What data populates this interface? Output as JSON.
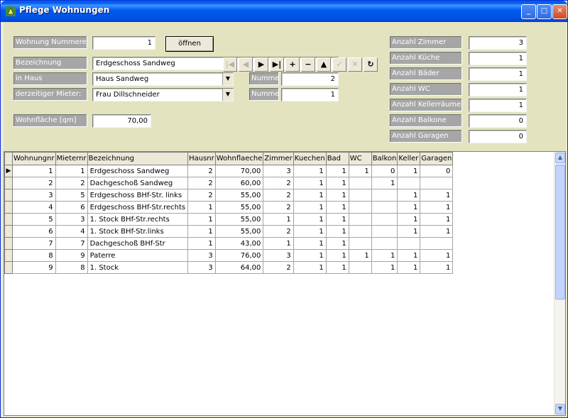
{
  "window": {
    "title": "Pflege Wohnungen",
    "minimize": "_",
    "maximize": "□",
    "close": "✕"
  },
  "form": {
    "wohnung_label": "Wohnung Nummerer",
    "wohnung_value": "1",
    "oeffnen_label": "öffnen",
    "bezeichnung_label": "Bezeichnung",
    "bezeichnung_value": "Erdgeschoss Sandweg",
    "haus_label": "in Haus",
    "haus_value": "Haus Sandweg",
    "haus_nummer_label": "Nummer",
    "haus_nummer_value": "2",
    "mieter_label": "derzeitiger Mieter:",
    "mieter_value": "Frau Dillschneider",
    "mieter_nummer_label": "Nummer",
    "mieter_nummer_value": "1",
    "flaeche_label": "Wohnfläche [qm]",
    "flaeche_value": "70,00"
  },
  "nav": {
    "first": "|◀",
    "prev": "◀",
    "next": "▶",
    "last": "▶|",
    "insert": "+",
    "delete": "−",
    "edit": "▲",
    "post": "✓",
    "cancel": "✕",
    "refresh": "↻"
  },
  "counts": {
    "zimmer_label": "Anzahl Zimmer",
    "zimmer_value": "3",
    "kueche_label": "Anzahl Küche",
    "kueche_value": "1",
    "baeder_label": "Anzahl Bäder",
    "baeder_value": "1",
    "wc_label": "Anzahl WC",
    "wc_value": "1",
    "keller_label": "Anzahl Kellerräume",
    "keller_value": "1",
    "balkone_label": "Anzahl Balkone",
    "balkone_value": "0",
    "garagen_label": "Anzahl Garagen",
    "garagen_value": "0"
  },
  "grid": {
    "columns": [
      "Wohnungnr",
      "Mieternr",
      "Bezeichnung",
      "Hausnr",
      "Wohnflaeche",
      "Zimmer",
      "Kuechen",
      "Bad",
      "WC",
      "Balkon",
      "Keller",
      "Garagen"
    ],
    "rows": [
      [
        "1",
        "1",
        "Erdgeschoss Sandweg",
        "2",
        "70,00",
        "3",
        "1",
        "1",
        "1",
        "0",
        "1",
        "0"
      ],
      [
        "2",
        "2",
        "Dachgeschoß Sandweg",
        "2",
        "60,00",
        "2",
        "1",
        "1",
        "",
        "1",
        "",
        ""
      ],
      [
        "3",
        "5",
        "Erdgeschoss BHf-Str. links",
        "2",
        "55,00",
        "2",
        "1",
        "1",
        "",
        "",
        "1",
        "1"
      ],
      [
        "4",
        "6",
        "Erdgeschoss BHf-Str.rechts",
        "1",
        "55,00",
        "2",
        "1",
        "1",
        "",
        "",
        "1",
        "1"
      ],
      [
        "5",
        "3",
        "1. Stock BHf-Str.rechts",
        "1",
        "55,00",
        "1",
        "1",
        "1",
        "",
        "",
        "1",
        "1"
      ],
      [
        "6",
        "4",
        "1. Stock BHf-Str.links",
        "1",
        "55,00",
        "2",
        "1",
        "1",
        "",
        "",
        "1",
        "1"
      ],
      [
        "7",
        "7",
        "Dachgeschoß BHf-Str",
        "1",
        "43,00",
        "1",
        "1",
        "1",
        "",
        "",
        "",
        ""
      ],
      [
        "8",
        "9",
        "Paterre",
        "3",
        "76,00",
        "3",
        "1",
        "1",
        "1",
        "1",
        "1",
        "1"
      ],
      [
        "9",
        "8",
        "1. Stock",
        "3",
        "64,00",
        "2",
        "1",
        "1",
        "",
        "1",
        "1",
        "1"
      ]
    ],
    "current_row_marker": "▶"
  }
}
